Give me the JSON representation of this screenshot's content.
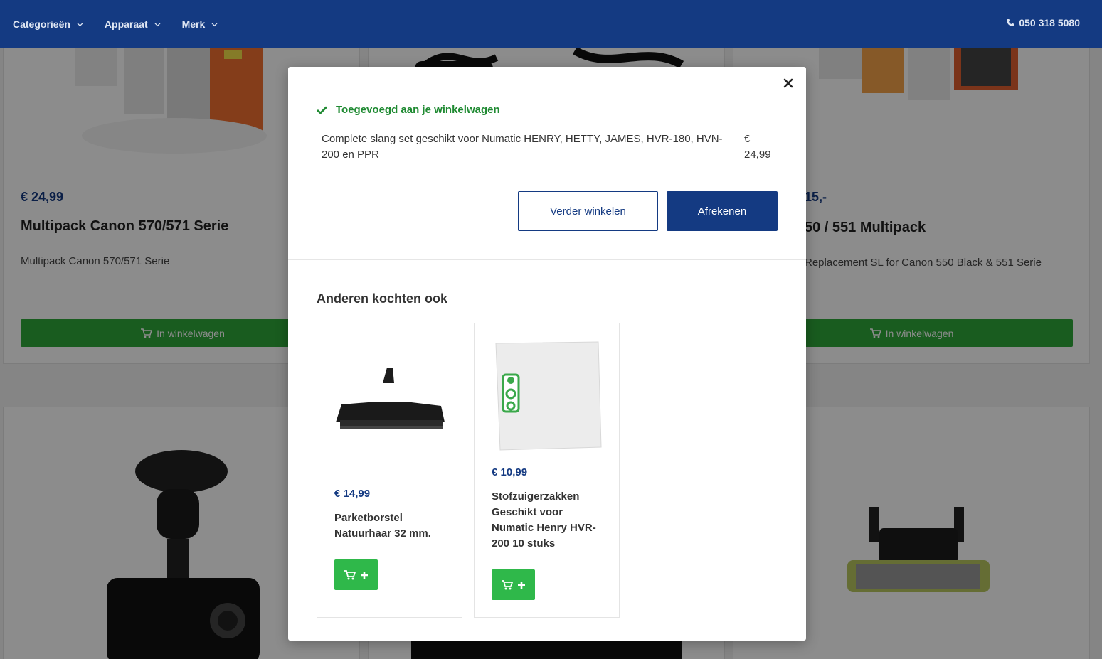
{
  "header": {
    "nav": [
      {
        "label": "Categorieën"
      },
      {
        "label": "Apparaat"
      },
      {
        "label": "Merk"
      }
    ],
    "phone": "050 318 5080"
  },
  "background": {
    "cards": [
      {
        "price": "€ 24,99",
        "title": "Multipack Canon 570/571 Serie",
        "desc": "Multipack Canon 570/571 Serie",
        "button": "In winkelwagen"
      },
      {
        "price": "15,-",
        "title": "50 / 551 Multipack",
        "desc": "Replacement SL for Canon 550 Black & 551 Serie",
        "button": "In winkelwagen"
      }
    ]
  },
  "modal": {
    "added_label": "Toegevoegd aan je winkelwagen",
    "item_name": "Complete slang set geschikt voor Numatic HENRY, HETTY, JAMES, HVR-180, HVN-200 en PPR",
    "item_price": "€ 24,99",
    "continue_label": "Verder winkelen",
    "checkout_label": "Afrekenen",
    "others_title": "Anderen kochten ook",
    "recommendations": [
      {
        "price": "€ 14,99",
        "title": "Parketborstel Natuurhaar 32 mm."
      },
      {
        "price": "€ 10,99",
        "title": "Stofzuigerzakken Geschikt voor Numatic Henry HVR-200 10 stuks"
      }
    ]
  },
  "colors": {
    "brand": "#143a82",
    "success": "#1f8a32",
    "cart_button": "#2fb84a"
  },
  "icons": [
    "chevron-down-icon",
    "phone-icon",
    "check-icon",
    "close-icon",
    "cart-icon",
    "plus-icon"
  ]
}
